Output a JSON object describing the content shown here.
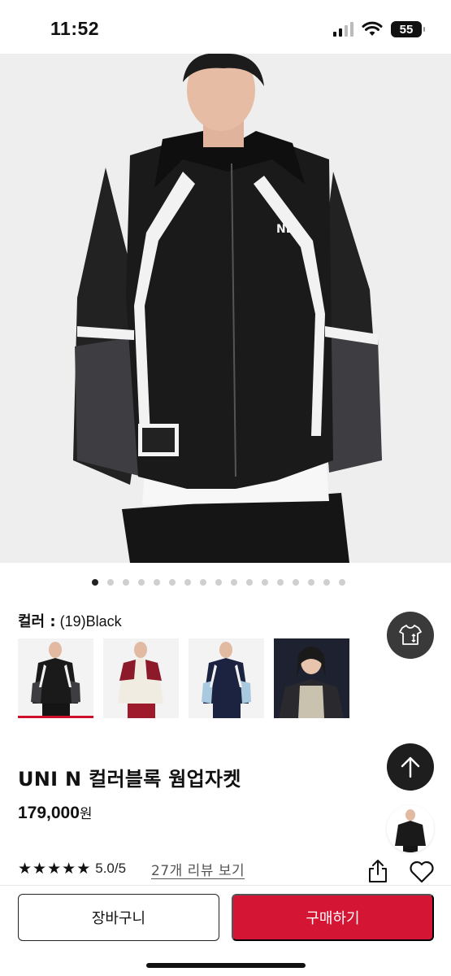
{
  "status_bar": {
    "time": "11:52",
    "battery": "55"
  },
  "carousel": {
    "total": 17,
    "active_index": 0
  },
  "color": {
    "label": "컬러 :",
    "value": "(19)Black"
  },
  "swatches": [
    {
      "name": "black",
      "selected": true
    },
    {
      "name": "red-cream",
      "selected": false
    },
    {
      "name": "navy-skyblue",
      "selected": false
    },
    {
      "name": "grey-black",
      "selected": false
    }
  ],
  "product": {
    "name": "UNI N 컬러블록 웜업자켓",
    "price": "179,000",
    "price_unit": "원"
  },
  "rating": {
    "stars": 5,
    "value": "5.0/5",
    "review_link": "27개 리뷰 보기"
  },
  "actions": {
    "cart_label": "장바구니",
    "buy_label": "구매하기"
  },
  "colors": {
    "buy_button": "#d41534",
    "selected_underline": "#d0102a"
  }
}
